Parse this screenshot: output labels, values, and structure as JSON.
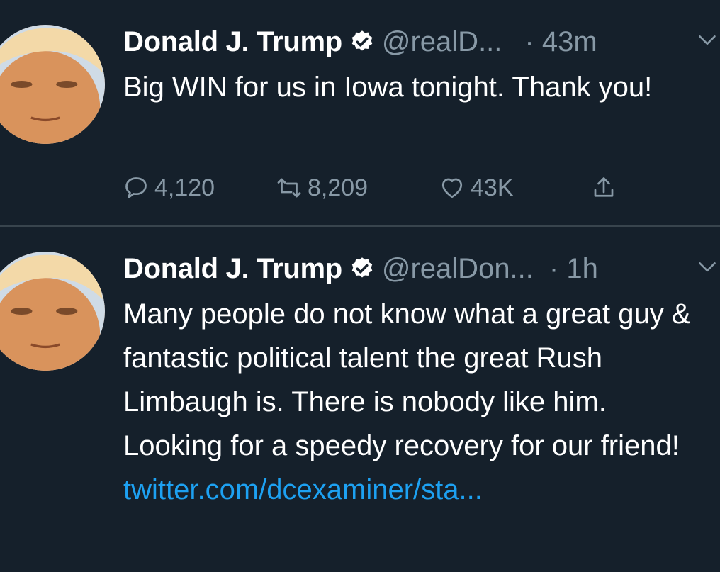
{
  "tweets": [
    {
      "author_name": "Donald J. Trump",
      "handle": "@realD...",
      "time": "· 43m",
      "text": "Big WIN for us in Iowa tonight. Thank you!",
      "replies": "4,120",
      "retweets": "8,209",
      "likes": "43K"
    },
    {
      "author_name": "Donald J. Trump",
      "handle": "@realDon...",
      "time": "· 1h",
      "text": "Many people do not know what a great guy & fantastic political talent the great Rush Limbaugh is. There is nobody like him. Looking for a speedy recovery for our friend!",
      "link": "twitter.com/dcexaminer/sta..."
    }
  ],
  "icons": {
    "verified": "verified-badge-icon",
    "chevron": "chevron-down-icon",
    "reply": "reply-icon",
    "retweet": "retweet-icon",
    "like": "heart-icon",
    "share": "share-icon"
  },
  "colors": {
    "background": "#15202b",
    "text": "#ffffff",
    "muted": "#8899a6",
    "link": "#1da1f2",
    "divider": "#38444d"
  }
}
